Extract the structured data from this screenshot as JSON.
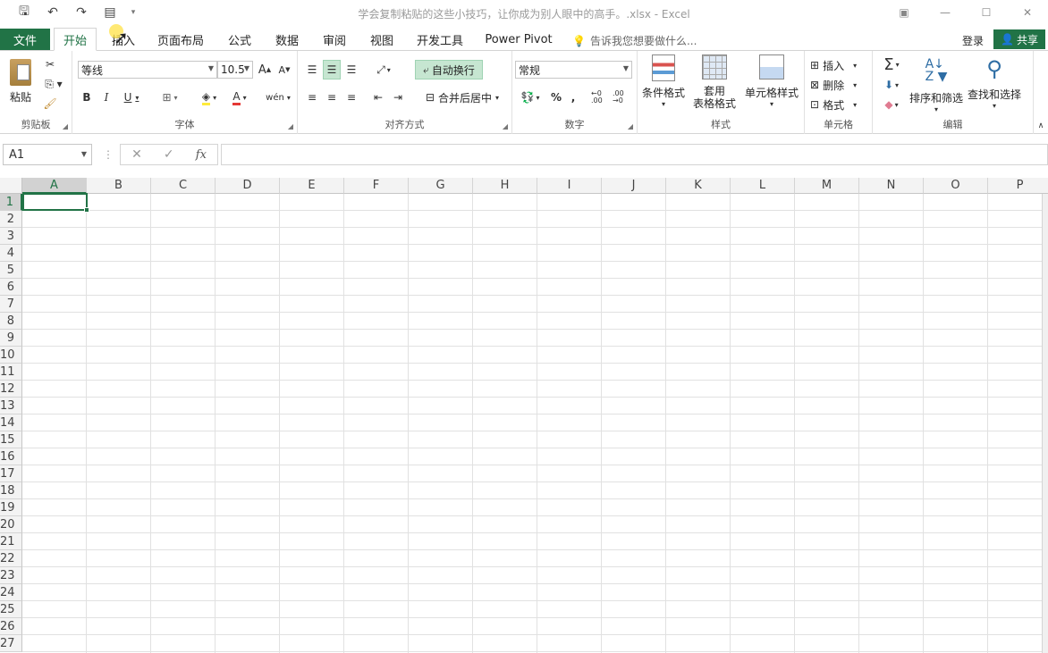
{
  "window": {
    "title": "学会复制粘贴的这些小技巧，让你成为别人眼中的高手。.xlsx - Excel",
    "controls": [
      "▣",
      "—",
      "☐",
      "✕"
    ]
  },
  "qat": {
    "save": "🖫",
    "undo": "↶",
    "redo": "↷",
    "form": "▤",
    "more": "▾"
  },
  "tabs": {
    "file": "文件",
    "items": [
      "开始",
      "插入",
      "页面布局",
      "公式",
      "数据",
      "审阅",
      "视图",
      "开发工具",
      "Power Pivot"
    ],
    "active": "开始",
    "tell_me": "告诉我您想要做什么...",
    "login": "登录",
    "share": "共享"
  },
  "ribbon": {
    "clipboard": {
      "paste": "粘贴",
      "label": "剪贴板"
    },
    "font": {
      "name": "等线",
      "size": "10.5",
      "grow": "A",
      "shrink": "A",
      "bold": "B",
      "italic": "I",
      "underline": "U",
      "phonetic": "wén",
      "label": "字体"
    },
    "alignment": {
      "wrap_text": "自动换行",
      "merge": "合并后居中",
      "label": "对齐方式"
    },
    "number": {
      "format": "常规",
      "percent": "%",
      "comma": ",",
      "inc_decimal": "←0 .00",
      "dec_decimal": ".00 →0",
      "label": "数字"
    },
    "styles": {
      "conditional": "条件格式",
      "table_line1": "套用",
      "table_line2": "表格格式",
      "cell_styles": "单元格样式",
      "label": "样式"
    },
    "cells": {
      "insert": "插入",
      "delete": "删除",
      "format": "格式",
      "label": "单元格"
    },
    "editing": {
      "sum": "Σ",
      "sort": "排序和筛选",
      "find": "查找和选择",
      "label": "编辑"
    }
  },
  "formula_bar": {
    "name_box": "A1",
    "cancel": "✕",
    "enter": "✓",
    "fx": "fx",
    "value": ""
  },
  "sheet": {
    "columns": [
      "A",
      "B",
      "C",
      "D",
      "E",
      "F",
      "G",
      "H",
      "I",
      "J",
      "K",
      "L",
      "M",
      "N",
      "O",
      "P"
    ],
    "rows": [
      "1",
      "2",
      "3",
      "4",
      "5",
      "6",
      "7",
      "8",
      "9",
      "10",
      "11",
      "12",
      "13",
      "14",
      "15",
      "16",
      "17",
      "18",
      "19",
      "20",
      "21",
      "22",
      "23",
      "24",
      "25",
      "26",
      "27"
    ],
    "active_cell": "A1"
  },
  "colors": {
    "excel_green": "#217346",
    "wrap_highlight": "#c6e6d1"
  }
}
